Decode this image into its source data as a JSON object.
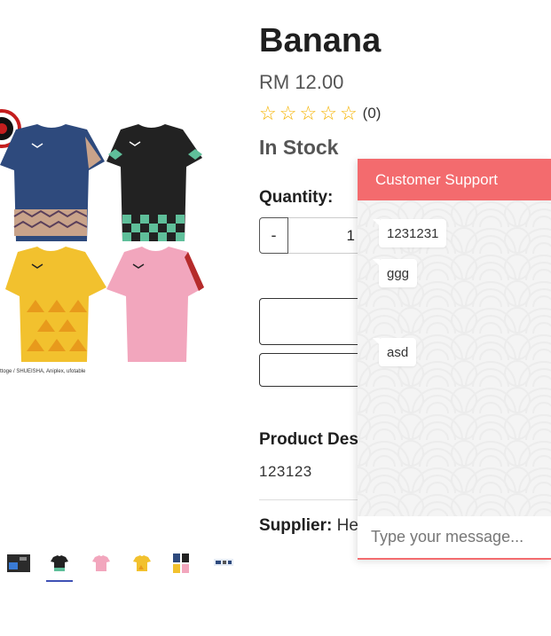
{
  "product": {
    "title": "Banana",
    "price": "RM 12.00",
    "rating": {
      "stars": 0,
      "max": 5,
      "count": "(0)"
    },
    "stock": "In Stock",
    "quantity_label": "Quantity:",
    "quantity": {
      "minus": "-",
      "value": "1"
    },
    "description_title": "Product Des",
    "description": "123123",
    "supplier_label": "Supplier:",
    "supplier_value": "He"
  },
  "gallery": {
    "copyright": "ttoge / SHUEISHA, Aniplex, ufotable",
    "thumbnails": [
      "thumb-dark",
      "thumb-black-tee",
      "thumb-pink-tee",
      "thumb-yellow-tee",
      "thumb-group",
      "thumb-logo"
    ]
  },
  "chat": {
    "title": "Customer Support",
    "messages": [
      "1231231",
      "ggg",
      "asd"
    ],
    "input_placeholder": "Type your message...",
    "accent": "#f36b6e"
  },
  "colors": {
    "star": "#f5b301",
    "tee_blue": "#2e4a7d",
    "tee_black": "#222222",
    "tee_yellow": "#f2c12e",
    "tee_pink": "#f2a6bd"
  }
}
